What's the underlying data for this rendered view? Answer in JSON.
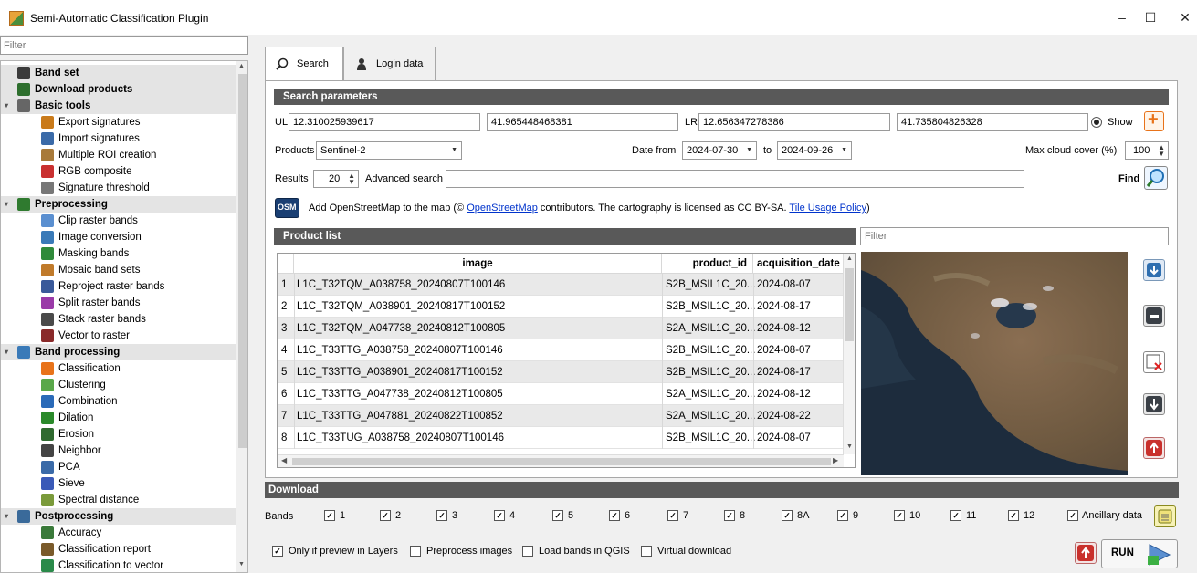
{
  "window": {
    "title": "Semi-Automatic Classification Plugin",
    "minimize_glyph": "–",
    "maximize_glyph": "☐",
    "close_glyph": "✕"
  },
  "left": {
    "filter_placeholder": "Filter",
    "items": [
      {
        "label": "Band set",
        "group": true,
        "expand": ""
      },
      {
        "label": "Download products",
        "group": true,
        "expand": ""
      },
      {
        "label": "Basic tools",
        "group": true,
        "expand": "▾"
      },
      {
        "label": "Export signatures",
        "group": false
      },
      {
        "label": "Import signatures",
        "group": false
      },
      {
        "label": "Multiple ROI creation",
        "group": false
      },
      {
        "label": "RGB composite",
        "group": false
      },
      {
        "label": "Signature threshold",
        "group": false
      },
      {
        "label": "Preprocessing",
        "group": true,
        "expand": "▾"
      },
      {
        "label": "Clip raster bands",
        "group": false
      },
      {
        "label": "Image conversion",
        "group": false
      },
      {
        "label": "Masking bands",
        "group": false
      },
      {
        "label": "Mosaic band sets",
        "group": false
      },
      {
        "label": "Reproject raster bands",
        "group": false
      },
      {
        "label": "Split raster bands",
        "group": false
      },
      {
        "label": "Stack raster bands",
        "group": false
      },
      {
        "label": "Vector to raster",
        "group": false
      },
      {
        "label": "Band processing",
        "group": true,
        "expand": "▾"
      },
      {
        "label": "Classification",
        "group": false
      },
      {
        "label": "Clustering",
        "group": false
      },
      {
        "label": "Combination",
        "group": false
      },
      {
        "label": "Dilation",
        "group": false
      },
      {
        "label": "Erosion",
        "group": false
      },
      {
        "label": "Neighbor",
        "group": false
      },
      {
        "label": "PCA",
        "group": false
      },
      {
        "label": "Sieve",
        "group": false
      },
      {
        "label": "Spectral distance",
        "group": false
      },
      {
        "label": "Postprocessing",
        "group": true,
        "expand": "▾"
      },
      {
        "label": "Accuracy",
        "group": false
      },
      {
        "label": "Classification report",
        "group": false
      },
      {
        "label": "Classification to vector",
        "group": false
      }
    ]
  },
  "tabs": [
    {
      "label": "Search",
      "icon": "search-icon"
    },
    {
      "label": "Login data",
      "icon": "user-icon"
    }
  ],
  "search": {
    "section_title": "Search parameters",
    "ul_label": "UL",
    "ul_x": "12.310025939617",
    "ul_y": "41.965448468381",
    "lr_label": "LR",
    "lr_x": "12.656347278386",
    "lr_y": "41.735804826328",
    "show_label": "Show",
    "products_label": "Products",
    "products_value": "Sentinel-2",
    "date_from_label": "Date from",
    "date_from": "2024-07-30",
    "to_label": "to",
    "date_to": "2024-09-26",
    "cloud_label": "Max cloud cover (%)",
    "cloud_value": "100",
    "results_label": "Results",
    "results_value": "20",
    "advanced_label": "Advanced search",
    "advanced_value": "",
    "find_label": "Find",
    "osm_badge": "OSM",
    "osm_text_pre": "Add OpenStreetMap to the map  (© ",
    "osm_link1": "OpenStreetMap",
    "osm_text_mid": " contributors. The cartography is licensed as CC BY-SA. ",
    "osm_link2": "Tile Usage Policy",
    "osm_text_post": ")"
  },
  "product_list": {
    "section_title": "Product list",
    "filter_placeholder": "Filter",
    "columns": [
      "image",
      "product_id",
      "acquisition_date"
    ],
    "rows": [
      {
        "n": "1",
        "image": "L1C_T32TQM_A038758_20240807T100146",
        "product_id": "S2B_MSIL1C_20...",
        "date": "2024-08-07"
      },
      {
        "n": "2",
        "image": "L1C_T32TQM_A038901_20240817T100152",
        "product_id": "S2B_MSIL1C_20...",
        "date": "2024-08-17"
      },
      {
        "n": "3",
        "image": "L1C_T32TQM_A047738_20240812T100805",
        "product_id": "S2A_MSIL1C_20...",
        "date": "2024-08-12"
      },
      {
        "n": "4",
        "image": "L1C_T33TTG_A038758_20240807T100146",
        "product_id": "S2B_MSIL1C_20...",
        "date": "2024-08-07"
      },
      {
        "n": "5",
        "image": "L1C_T33TTG_A038901_20240817T100152",
        "product_id": "S2B_MSIL1C_20...",
        "date": "2024-08-17"
      },
      {
        "n": "6",
        "image": "L1C_T33TTG_A047738_20240812T100805",
        "product_id": "S2A_MSIL1C_20...",
        "date": "2024-08-12"
      },
      {
        "n": "7",
        "image": "L1C_T33TTG_A047881_20240822T100852",
        "product_id": "S2A_MSIL1C_20...",
        "date": "2024-08-22"
      },
      {
        "n": "8",
        "image": "L1C_T33TUG_A038758_20240807T100146",
        "product_id": "S2B_MSIL1C_20...",
        "date": "2024-08-07"
      }
    ]
  },
  "download": {
    "section_title": "Download",
    "bands_label": "Bands",
    "bands": [
      "1",
      "2",
      "3",
      "4",
      "5",
      "6",
      "7",
      "8",
      "8A",
      "9",
      "10",
      "11",
      "12"
    ],
    "ancillary_label": "Ancillary data",
    "options": [
      {
        "label": "Only if preview in Layers",
        "checked": true
      },
      {
        "label": "Preprocess images",
        "checked": false
      },
      {
        "label": "Load bands in QGIS",
        "checked": false
      },
      {
        "label": "Virtual download",
        "checked": false
      }
    ],
    "run_label": "RUN",
    "check_glyph": "✓"
  },
  "colors": {
    "section_bar": "#595959",
    "accent_orange": "#e8731a",
    "link": "#0033cc"
  }
}
